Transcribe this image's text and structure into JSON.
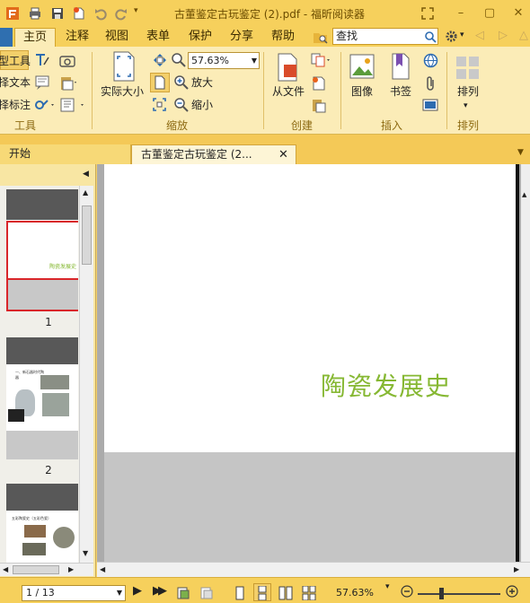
{
  "app": {
    "title": "古董鉴定古玩鉴定 (2).pdf - 福昕阅读器"
  },
  "menu": {
    "tabs": [
      "主页",
      "注释",
      "视图",
      "表单",
      "保护",
      "分享",
      "帮助"
    ],
    "active_tab": "主页",
    "search_placeholder": "查找"
  },
  "ribbon": {
    "tools": {
      "hand_tool": "手型工具",
      "select_text": "选择文本",
      "select_annot": "选择标注",
      "group_label": "工具"
    },
    "zoom": {
      "actual_size": "实际大小",
      "zoom_value": "57.63%",
      "zoom_in": "放大",
      "zoom_out": "缩小",
      "group_label": "缩放"
    },
    "create": {
      "from_file": "从文件",
      "group_label": "创建"
    },
    "insert": {
      "image": "图像",
      "bookmark": "书签",
      "group_label": "插入"
    },
    "arrange": {
      "arrange": "排列",
      "group_label": "排列"
    }
  },
  "doc_tabs": {
    "home": "开始",
    "file": "古董鉴定古玩鉴定 (2..."
  },
  "thumbnails": {
    "pages": [
      "1",
      "2"
    ],
    "thumb1_title": "陶瓷发展史",
    "thumb2_text": "一、新石器时代陶器",
    "thumb3_text": "五彩陶瓷史（五彩色瓷）"
  },
  "document": {
    "page_title": "陶瓷发展史"
  },
  "status": {
    "page_indicator": "1 / 13",
    "zoom_pct": "57.63%"
  },
  "colors": {
    "ribbon_bg": "#fbecb7",
    "title_bg": "#f6d05c",
    "accent_green": "#86b833",
    "thumb_red": "#d9262a"
  }
}
